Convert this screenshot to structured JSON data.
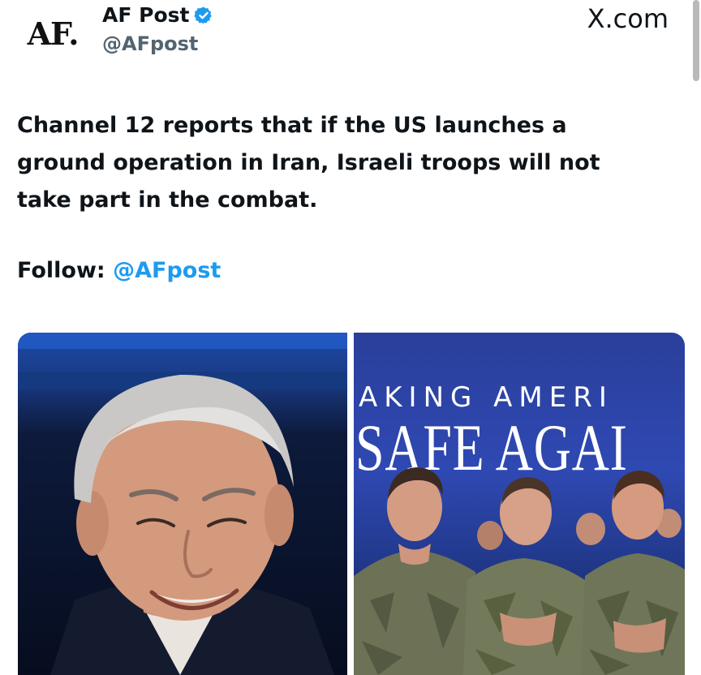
{
  "author": {
    "avatar_text": "AF.",
    "display_name": "AF Post",
    "handle": "@AFpost",
    "verified": true
  },
  "site_label": "X.com",
  "tweet": {
    "text_lines": [
      "Channel 12 reports that if the US launches a",
      "ground operation in Iran, Israeli troops will not",
      "take part in the combat."
    ],
    "follow_label": "Follow:",
    "follow_mention": "@AFpost"
  },
  "media": {
    "banner_line1": "AKING AMERI",
    "banner_line2": "SAFE AGAI"
  },
  "colors": {
    "accent": "#1d9bf0",
    "text": "#0f1419",
    "secondary_text": "#536471"
  }
}
